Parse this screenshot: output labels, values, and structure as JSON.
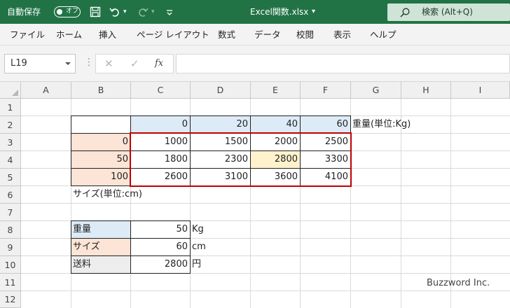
{
  "titlebar": {
    "autosave_label": "自動保存",
    "autosave_state": "オフ",
    "file_name": "Excel関数.xlsx",
    "file_dropdown_arrow": "▾",
    "search_placeholder": "検索 (Alt+Q)",
    "icons": [
      "save-icon",
      "undo-icon",
      "redo-icon",
      "customize-icon",
      "search-icon"
    ]
  },
  "ribbon": {
    "tabs": [
      "ファイル",
      "ホーム",
      "挿入",
      "ページ レイアウト",
      "数式",
      "データ",
      "校閲",
      "表示",
      "ヘルプ"
    ]
  },
  "formula_bar": {
    "name_box": "L19",
    "cancel_glyph": "✕",
    "enter_glyph": "✓",
    "fx_label": "fx",
    "formula": ""
  },
  "columns": [
    "A",
    "B",
    "C",
    "D",
    "E",
    "F",
    "G",
    "H",
    "I"
  ],
  "rows": [
    "1",
    "2",
    "3",
    "4",
    "5",
    "6",
    "7",
    "8",
    "9",
    "10",
    "11",
    "12"
  ],
  "cells": {
    "C2": "0",
    "D2": "20",
    "E2": "40",
    "F2": "60",
    "G2": "重量(単位:Kg)",
    "B3": "0",
    "C3": "1000",
    "D3": "1500",
    "E3": "2000",
    "F3": "2500",
    "B4": "50",
    "C4": "1800",
    "D4": "2300",
    "E4": "2800",
    "F4": "3300",
    "B5": "100",
    "C5": "2600",
    "D5": "3100",
    "E5": "3600",
    "F5": "4100",
    "B6": "サイズ(単位:cm)",
    "B8": "重量",
    "C8": "50",
    "D8": "Kg",
    "B9": "サイズ",
    "C9": "60",
    "D9": "cm",
    "B10": "送料",
    "C10": "2800",
    "D10": "円"
  },
  "colors": {
    "title_bar": "#217346",
    "header_blue": "#ddebf7",
    "header_peach": "#fce4d6",
    "highlight_yellow": "#fff2cc",
    "label_gray": "#ededed",
    "range_border_red": "#c00000"
  },
  "watermark": "Buzzword Inc."
}
